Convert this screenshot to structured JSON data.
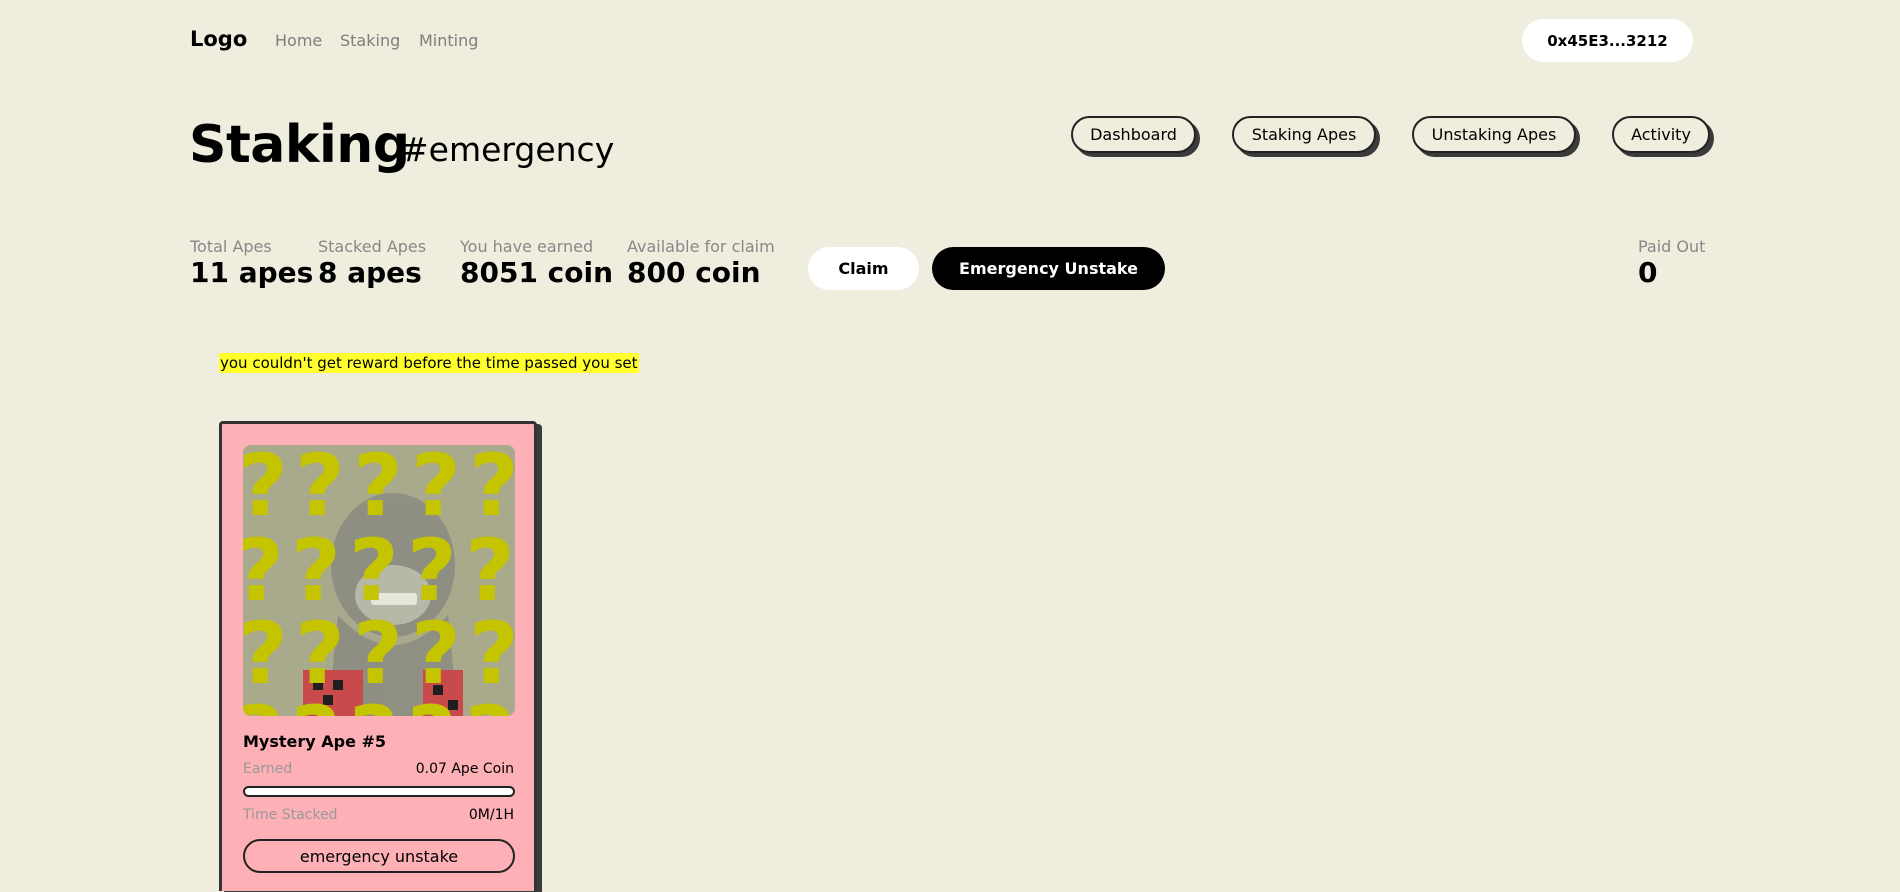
{
  "nav": {
    "logo": "Logo",
    "links": [
      "Home",
      "Staking",
      "Minting"
    ],
    "wallet": "0x45E3...3212"
  },
  "header": {
    "title": "Staking",
    "tag": "#emergency",
    "tabs": [
      "Dashboard",
      "Staking Apes",
      "Unstaking Apes",
      "Activity"
    ]
  },
  "stats": [
    {
      "label": "Total Apes",
      "value": "11 apes"
    },
    {
      "label": "Stacked Apes",
      "value": "8 apes"
    },
    {
      "label": "You have earned",
      "value": "8051 coin"
    },
    {
      "label": "Available for claim",
      "value": "800 coin"
    }
  ],
  "paid_out": {
    "label": "Paid Out",
    "value": "0"
  },
  "actions": {
    "claim": "Claim",
    "emergency_unstake": "Emergency Unstake"
  },
  "notice": "you couldn't get reward before the time passed you set",
  "card": {
    "name": "Mystery Ape #5",
    "earned_label": "Earned",
    "earned_value": "0.07 Ape Coin",
    "progress": 0,
    "time_label": "Time Stacked",
    "time_value": "0M/1H",
    "button": "emergency unstake"
  },
  "colors": {
    "background": "#efedde",
    "card": "#fdb0b6",
    "highlight": "#ffff2e",
    "question_marks": "#c4c400"
  }
}
